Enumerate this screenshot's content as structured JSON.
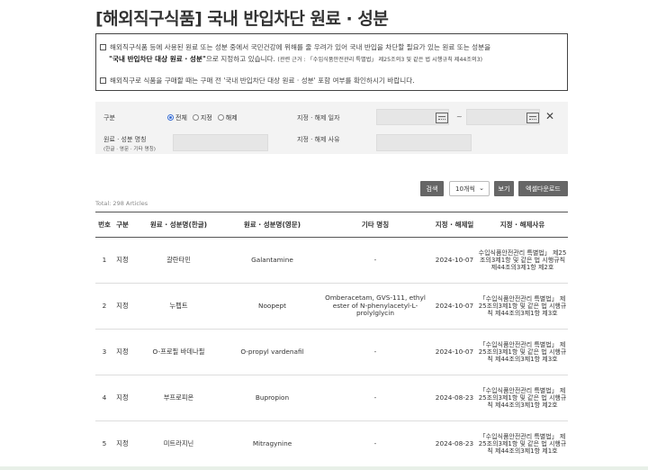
{
  "page": {
    "title": "[해외직구식품] 국내 반입차단 원료 · 성분"
  },
  "notice": {
    "line1": "해외직구식품 등에 사용된 원료 또는 성분 중에서 국민건강에 위해를 줄 우려가 있어 국내 반입을 차단할 필요가 있는 원료 또는 성분을",
    "line2_bold": "\"국내 반입차단 대상 원료 · 성분\"",
    "line2_rest": "으로 지정하고 있습니다.",
    "line2_small": "(관련 근거 : 「수입식품안전관리 특별법」 제25조의3 및 같은 법 시행규칙 제44조의3)",
    "line3": "해외직구로 식품을 구매할 때는 구매 전 '국내 반입차단 대상 원료 · 성분' 포함 여부를 확인하시기 바랍니다."
  },
  "search": {
    "type_label": "구분",
    "radios": [
      {
        "label": "전체",
        "checked": true
      },
      {
        "label": "지정",
        "checked": false
      },
      {
        "label": "해제",
        "checked": false
      }
    ],
    "date_label": "지정 · 해제 일자",
    "date_separator": "~",
    "name_label": "원료 · 성분 명칭",
    "name_sub": "(한글 · 영문 · 기타 명칭)",
    "reason_label": "지정 · 해제 사유",
    "name_value": "",
    "reason_value": ""
  },
  "toolbar": {
    "search_label": "검색",
    "page_size": "10개씩",
    "view_label": "보기",
    "excel_label": "엑셀다운로드"
  },
  "total": "Total: 298 Articles",
  "table": {
    "headers": [
      "번호",
      "구분",
      "원료 · 성분명(한글)",
      "원료 · 성분명(영문)",
      "기타 명칭",
      "지정 · 해제일",
      "지정 · 해제사유"
    ],
    "rows": [
      {
        "no": "1",
        "type": "지정",
        "ko": "갈란타민",
        "en": "Galantamine",
        "other": "-",
        "date": "2024-10-07",
        "basis": "수입식품안전관리 특별법」 제25조의3제1항 및 같은 법 시행규칙 제44조의3제1항 제2호"
      },
      {
        "no": "2",
        "type": "지정",
        "ko": "누펩트",
        "en": "Noopept",
        "other": "Omberacetam, GVS-111, ethyl ester of N-phenylacetyl-L-prolylglycin",
        "date": "2024-10-07",
        "basis": "「수입식품안전관리 특별법」 제25조의3제1항 및 같은 법 시행규칙 제44조의3제1항 제3호"
      },
      {
        "no": "3",
        "type": "지정",
        "ko": "O-프로필 바데나필",
        "en": "O-propyl vardenafil",
        "other": "-",
        "date": "2024-10-07",
        "basis": "「수입식품안전관리 특별법」 제25조의3제1항 및 같은 법 시행규칙 제44조의3제1항 제3호"
      },
      {
        "no": "4",
        "type": "지정",
        "ko": "부프로피온",
        "en": "Bupropion",
        "other": "-",
        "date": "2024-08-23",
        "basis": "「수입식품안전관리 특별법」 제25조의3제1항 및 같은 법 시행규칙 제44조의3제1항 제2호"
      },
      {
        "no": "5",
        "type": "지정",
        "ko": "미트라지닌",
        "en": "Mitragynine",
        "other": "-",
        "date": "2024-08-23",
        "basis": "「수입식품안전관리 특별법」 제25조의3제1항 및 같은 법 시행규칙 제44조의3제1항 제1호"
      }
    ]
  }
}
